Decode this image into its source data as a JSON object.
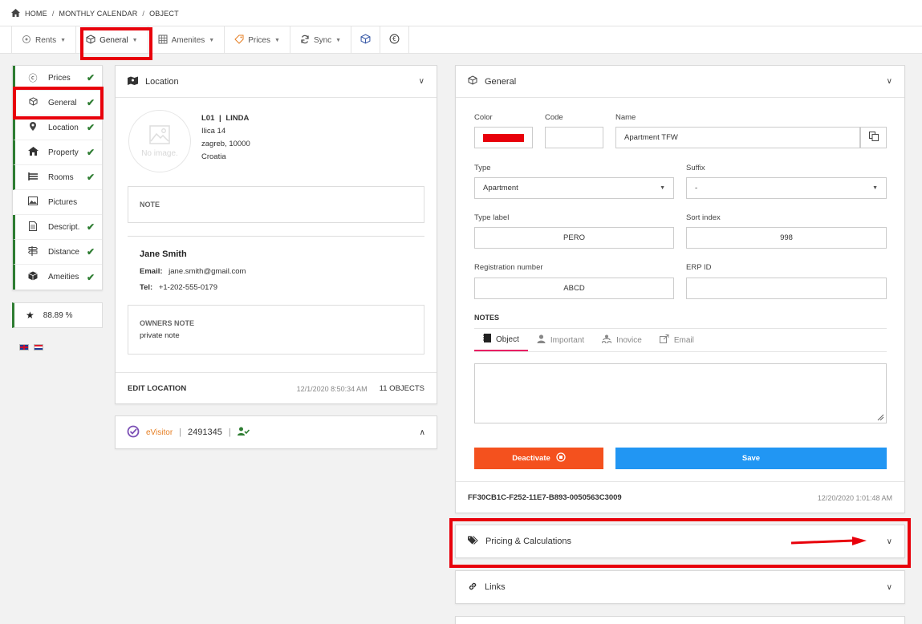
{
  "breadcrumb": {
    "items": [
      "HOME",
      "MONTHLY CALENDAR",
      "OBJECT"
    ],
    "separator": "/"
  },
  "toolbar": {
    "tabs": [
      {
        "label": "Rents",
        "icon": "rents-icon"
      },
      {
        "label": "General",
        "icon": "cube-icon"
      },
      {
        "label": "Amenites",
        "icon": "grid-icon"
      },
      {
        "label": "Prices",
        "icon": "tag-icon"
      },
      {
        "label": "Sync",
        "icon": "sync-icon"
      }
    ],
    "icon_buttons": [
      "cube-icon",
      "euro-icon"
    ]
  },
  "sidebar": {
    "items": [
      {
        "label": "Prices",
        "icon": "euro-icon",
        "checked": true
      },
      {
        "label": "General",
        "icon": "cube-icon",
        "checked": true
      },
      {
        "label": "Location",
        "icon": "map-pin-icon",
        "checked": true
      },
      {
        "label": "Property",
        "icon": "house-icon",
        "checked": true
      },
      {
        "label": "Rooms",
        "icon": "bed-icon",
        "checked": true
      },
      {
        "label": "Pictures",
        "icon": "image-icon",
        "checked": false
      },
      {
        "label": "Descript.",
        "icon": "document-icon",
        "checked": true
      },
      {
        "label": "Distance",
        "icon": "signpost-icon",
        "checked": true
      },
      {
        "label": "Ameities",
        "icon": "box-icon",
        "checked": true
      }
    ],
    "score": "88.89 %"
  },
  "location": {
    "title": "Location",
    "no_image": "No image.",
    "code": "L01",
    "name": "LINDA",
    "street": "Ilica 14",
    "city": "zagreb, 10000",
    "country": "Croatia",
    "note_label": "NOTE",
    "owner_name": "Jane Smith",
    "email_label": "Email:",
    "email": "jane.smith@gmail.com",
    "tel_label": "Tel:",
    "tel": "+1-202-555-0179",
    "owners_note_label": "OWNERS NOTE",
    "owners_note": "private note",
    "edit_label": "EDIT LOCATION",
    "date": "12/1/2020 8:50:34 AM",
    "objects": "11 OBJECTS"
  },
  "evisitor": {
    "logo": "eVisitor",
    "id": "2491345"
  },
  "general": {
    "title": "General",
    "color_label": "Color",
    "color_value": "#e8000b",
    "code_label": "Code",
    "code_value": "",
    "name_label": "Name",
    "name_value": "Apartment TFW",
    "type_label": "Type",
    "type_value": "Apartment",
    "suffix_label": "Suffix",
    "suffix_value": "-",
    "type_label_label": "Type label",
    "type_label_value": "PERO",
    "sort_index_label": "Sort index",
    "sort_index_value": "998",
    "reg_label": "Registration number",
    "reg_value": "ABCD",
    "erp_label": "ERP ID",
    "erp_value": "",
    "notes_title": "NOTES",
    "note_tabs": [
      "Object",
      "Important",
      "Inovice",
      "Email"
    ],
    "deactivate_label": "Deactivate",
    "save_label": "Save",
    "guid": "FF30CB1C-F252-11E7-B893-0050563C3009",
    "date": "12/20/2020 1:01:48 AM"
  },
  "sections": {
    "pricing": "Pricing & Calculations",
    "links": "Links"
  },
  "colors": {
    "accent_green": "#2e7d32",
    "deactivate": "#f4511e",
    "save": "#2196f3",
    "annotation_red": "#e8000b",
    "tab_underline": "#e91e63"
  }
}
